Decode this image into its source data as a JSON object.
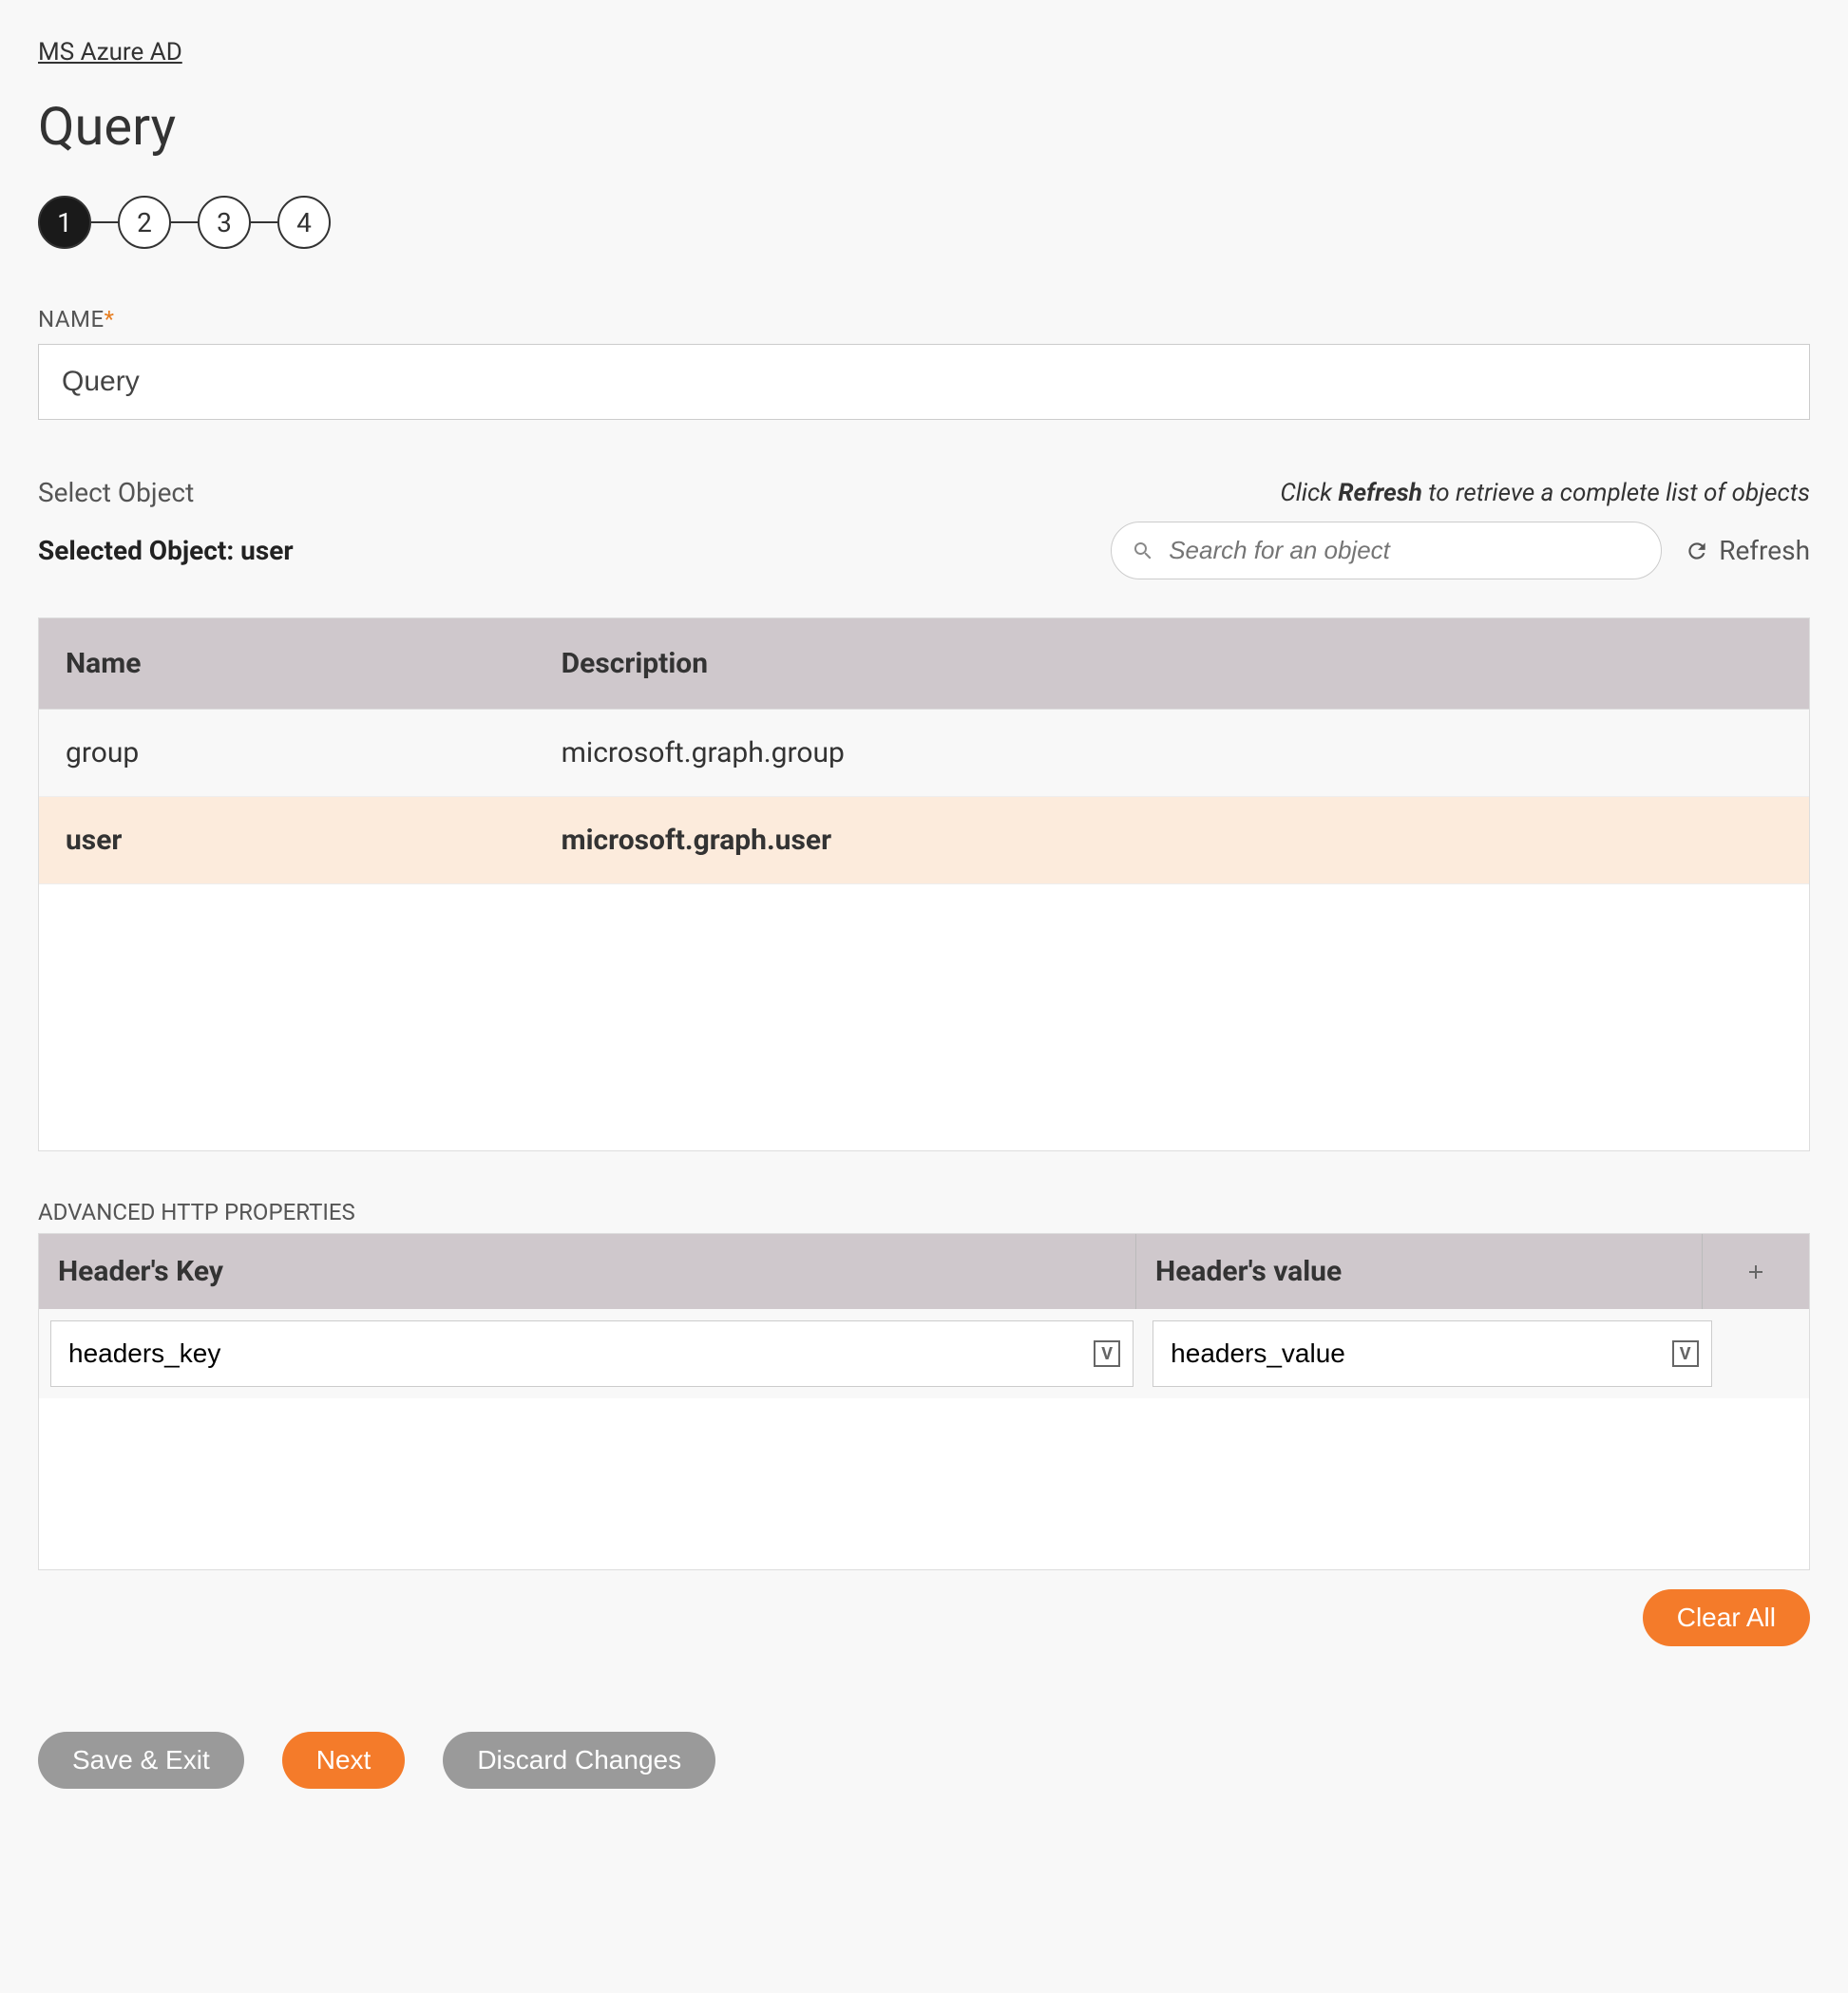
{
  "breadcrumb": "MS Azure AD",
  "page_title": "Query",
  "stepper": {
    "steps": [
      "1",
      "2",
      "3",
      "4"
    ],
    "active": 0
  },
  "name_field": {
    "label": "NAME",
    "value": "Query"
  },
  "select_object": {
    "label": "Select Object",
    "hint_prefix": "Click ",
    "hint_bold": "Refresh",
    "hint_suffix": " to retrieve a complete list of objects",
    "selected_label_prefix": "Selected Object: ",
    "selected_value": "user",
    "search_placeholder": "Search for an object",
    "refresh_label": "Refresh"
  },
  "object_table": {
    "headers": {
      "name": "Name",
      "description": "Description"
    },
    "rows": [
      {
        "name": "group",
        "description": "microsoft.graph.group",
        "selected": false
      },
      {
        "name": "user",
        "description": "microsoft.graph.user",
        "selected": true
      }
    ]
  },
  "advanced": {
    "label": "ADVANCED HTTP PROPERTIES",
    "headers": {
      "key": "Header's Key",
      "value": "Header's value"
    },
    "rows": [
      {
        "key": "headers_key",
        "value": "headers_value"
      }
    ],
    "var_badge": "V"
  },
  "buttons": {
    "clear_all": "Clear All",
    "save_exit": "Save & Exit",
    "next": "Next",
    "discard": "Discard Changes"
  }
}
